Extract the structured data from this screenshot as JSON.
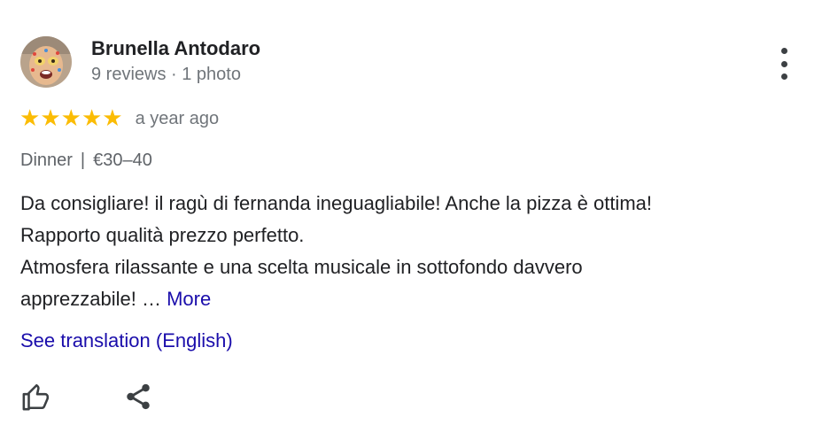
{
  "review": {
    "author": {
      "name": "Brunella Antodaro",
      "meta": "9 reviews · 1 photo",
      "avatar_icon": "user-avatar-photo"
    },
    "more_options_icon": "more-vert-icon",
    "rating": {
      "stars": 5,
      "max_stars": 5,
      "star_glyph": "★",
      "star_color": "#fbbc04"
    },
    "date": "a year ago",
    "meal": {
      "type": "Dinner",
      "separator": "|",
      "price": "€30–40"
    },
    "text_lines": [
      "Da consigliare! il ragù di fernanda ineguagliabile! Anche la pizza è ottima!",
      "Rapporto qualità prezzo perfetto.",
      "Atmosfera rilassante e una scelta musicale in sottofondo davvero",
      "apprezzabile! … "
    ],
    "more_label": "More",
    "translate_label": "See translation (English)",
    "actions": {
      "like_icon": "thumbs-up-icon",
      "share_icon": "share-icon"
    },
    "colors": {
      "link": "#1a0dab",
      "secondary_text": "#70757a",
      "primary_text": "#202124"
    }
  }
}
